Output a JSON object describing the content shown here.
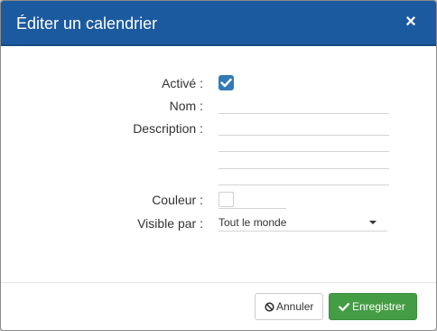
{
  "dialog": {
    "title": "Éditer un calendrier",
    "close_glyph": "×",
    "accent_color": "#1c5aa0"
  },
  "form": {
    "active": {
      "label": "Activé :",
      "checked": true
    },
    "name": {
      "label": "Nom :",
      "value": ""
    },
    "description": {
      "label": "Description :",
      "value": ""
    },
    "color": {
      "label": "Couleur :",
      "value": "#ffffff"
    },
    "visible_by": {
      "label": "Visible par :",
      "selected": "Tout le monde"
    }
  },
  "footer": {
    "cancel": {
      "label": "Annuler",
      "icon": "ban-icon"
    },
    "save": {
      "label": "Enregistrer",
      "icon": "check-icon",
      "color": "#449d44"
    }
  }
}
